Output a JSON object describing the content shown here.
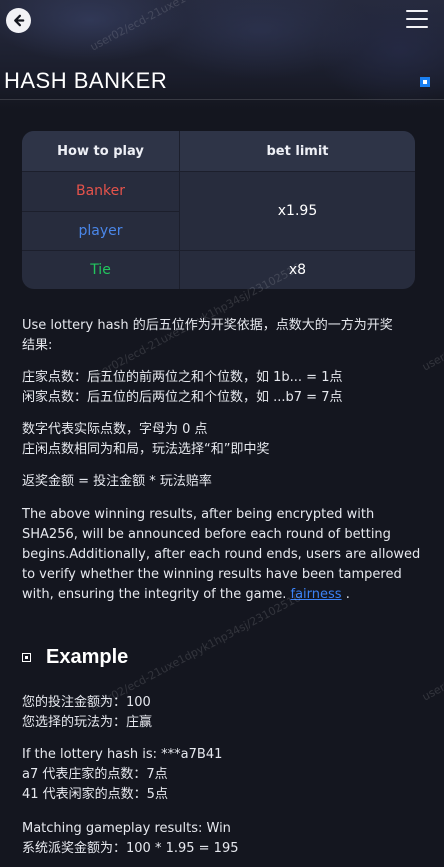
{
  "header": {
    "title": "HASH BANKER",
    "back_icon": "back-arrow-icon",
    "menu_icon": "hamburger-menu-icon"
  },
  "table": {
    "headers": [
      "How to play",
      "bet limit"
    ],
    "rows": [
      {
        "play": "Banker",
        "color": "#e5534b"
      },
      {
        "play": "player",
        "color": "#4a86e8"
      },
      {
        "play": "Tie",
        "color": "#22c55e"
      }
    ],
    "limits": {
      "banker_player": "x1.95",
      "tie": "x8"
    }
  },
  "rules": {
    "intro_line1": "Use lottery hash 的后五位作为开奖依据，点数大的一方为开奖",
    "intro_line2": "结果:",
    "banker_points": "庄家点数：后五位的前两位之和个位数，如 1b... = 1点",
    "player_points": "闲家点数：后五位的后两位之和个位数，如 ...b7 = 7点",
    "digit_rule": "数字代表实际点数，字母为 0 点",
    "tie_rule": "庄闲点数相同为和局，玩法选择“和”即中奖",
    "payout_rule": "返奖金额 = 投注金额 * 玩法赔率",
    "fairness_text": "The above winning results, after being encrypted with SHA256, will be announced before each round of betting begins.Additionally, after each round ends, users are allowed to verify whether the winning results have been tampered with, ensuring the integrity of the game.",
    "fairness_link": "fairness",
    "fairness_end": "."
  },
  "example": {
    "heading": "Example",
    "bet_amount": "您的投注金额为：100",
    "selected_play": "您选择的玩法为：庄赢",
    "hash_line": "If the lottery hash is: ***a7B41",
    "banker_line": "a7 代表庄家的点数：7点",
    "player_line": "41 代表闲家的点数：5点",
    "result_line": "Matching gameplay results: Win",
    "payout_line": "系统派奖金额为：100 * 1.95 = 195"
  },
  "watermarks": {
    "main": "user02/ecd-21uxe1dpyk1hp34sj/23102516",
    "edge": "user02/e"
  },
  "colors": {
    "accent_blue": "#1a7ff0",
    "link": "#3b82f6",
    "banker": "#e5534b",
    "player": "#4a86e8",
    "tie": "#22c55e"
  }
}
